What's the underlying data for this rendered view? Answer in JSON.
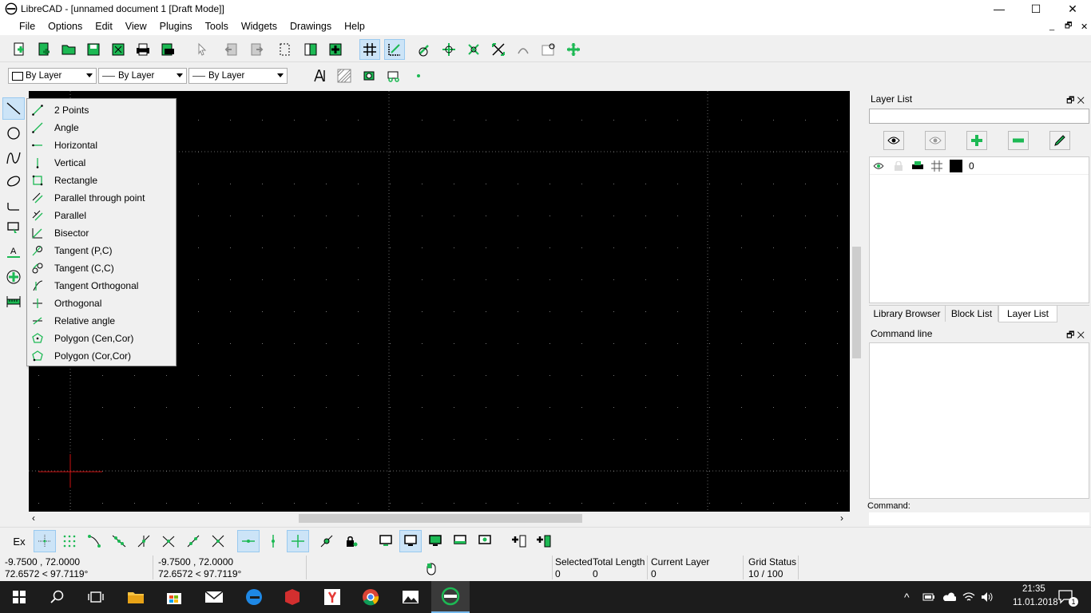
{
  "window": {
    "title": "LibreCAD - [unnamed document 1 [Draft Mode]]",
    "minimize": "—",
    "maximize": "☐",
    "close": "✕"
  },
  "menu": [
    "File",
    "Options",
    "Edit",
    "View",
    "Plugins",
    "Tools",
    "Widgets",
    "Drawings",
    "Help"
  ],
  "mdi_controls": [
    "_",
    "🗗",
    "✕"
  ],
  "pen_toolbar": {
    "color": "By Layer",
    "width": "By Layer",
    "type": "By Layer"
  },
  "line_menu": [
    "2 Points",
    "Angle",
    "Horizontal",
    "Vertical",
    "Rectangle",
    "Parallel through point",
    "Parallel",
    "Bisector",
    "Tangent (P,C)",
    "Tangent (C,C)",
    "Tangent Orthogonal",
    "Orthogonal",
    "Relative angle",
    "Polygon (Cen,Cor)",
    "Polygon (Cor,Cor)"
  ],
  "layer_list": {
    "title": "Layer List",
    "layer_name": "0"
  },
  "dock_tabs": [
    "Library Browser",
    "Block List",
    "Layer List"
  ],
  "command_line": {
    "title": "Command line",
    "prompt": "Command:"
  },
  "snap_toolbar": {
    "exclusive": "Ex"
  },
  "status": {
    "abs_coord": "-9.7500 , 72.0000",
    "abs_polar": "72.6572 < 97.7119°",
    "rel_coord": "-9.7500 , 72.0000",
    "rel_polar": "72.6572 < 97.7119°",
    "selected_label": "Selected",
    "selected_value": "0",
    "total_length_label": "Total Length",
    "total_length_value": "0",
    "current_layer_label": "Current Layer",
    "current_layer_value": "0",
    "grid_status_label": "Grid Status",
    "grid_status_value": "10 / 100"
  },
  "taskbar": {
    "time": "21:35",
    "date": "11.01.2018",
    "notifications": "1"
  },
  "colors": {
    "canvas": "#000000",
    "accent_green": "#1db954",
    "active_button": "#cce4f7"
  }
}
